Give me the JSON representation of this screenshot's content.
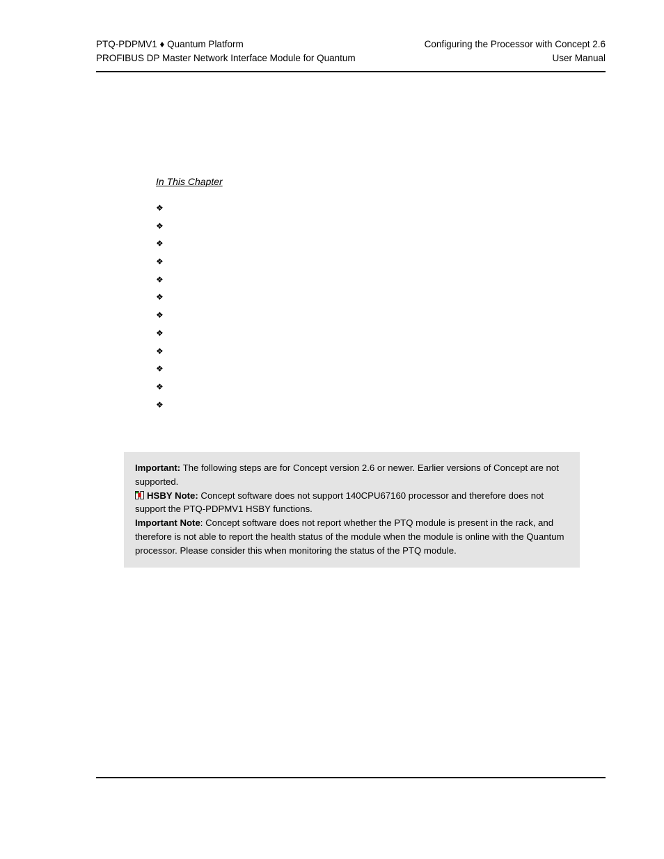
{
  "header": {
    "left_line1": "PTQ-PDPMV1 ♦ Quantum Platform",
    "left_line2": "PROFIBUS DP Master Network Interface Module for Quantum",
    "right_line1": "Configuring the Processor with Concept 2.6",
    "right_line2": "User Manual"
  },
  "chapter": {
    "toc_heading": "In This Chapter",
    "bullet_glyph": "❖",
    "entries": [
      {
        "label": "",
        "page": ""
      },
      {
        "label": "",
        "page": ""
      },
      {
        "label": "",
        "page": ""
      },
      {
        "label": "",
        "page": ""
      },
      {
        "label": "",
        "page": ""
      },
      {
        "label": "",
        "page": ""
      },
      {
        "label": "",
        "page": ""
      },
      {
        "label": "",
        "page": ""
      },
      {
        "label": "",
        "page": ""
      },
      {
        "label": "",
        "page": ""
      },
      {
        "label": "",
        "page": ""
      },
      {
        "label": "",
        "page": ""
      }
    ]
  },
  "note_box": {
    "background_color": "#e4e4e4",
    "important_lead": "Important:",
    "important_text": " The following steps are for Concept version 2.6 or newer. Earlier versions of Concept are not supported.",
    "hsby_lead": "HSBY Note:",
    "hsby_text": " Concept software does not support 140CPU67160 processor and therefore does not support the PTQ-PDPMV1 HSBY functions.",
    "important_note_lead": "Important Note",
    "important_note_text": ": Concept software does not report whether the PTQ module is present in the rack, and therefore is not able to report the health status of the module when the module is online with the Quantum processor. Please consider this when monitoring the status of the PTQ module.",
    "hsby_icon_name": "hsby-redundancy-icon",
    "hsby_icon_colors": {
      "module": "#1a1a1a",
      "ok_indicator": "#19a219",
      "alarm_indicator": "#d21414"
    }
  }
}
